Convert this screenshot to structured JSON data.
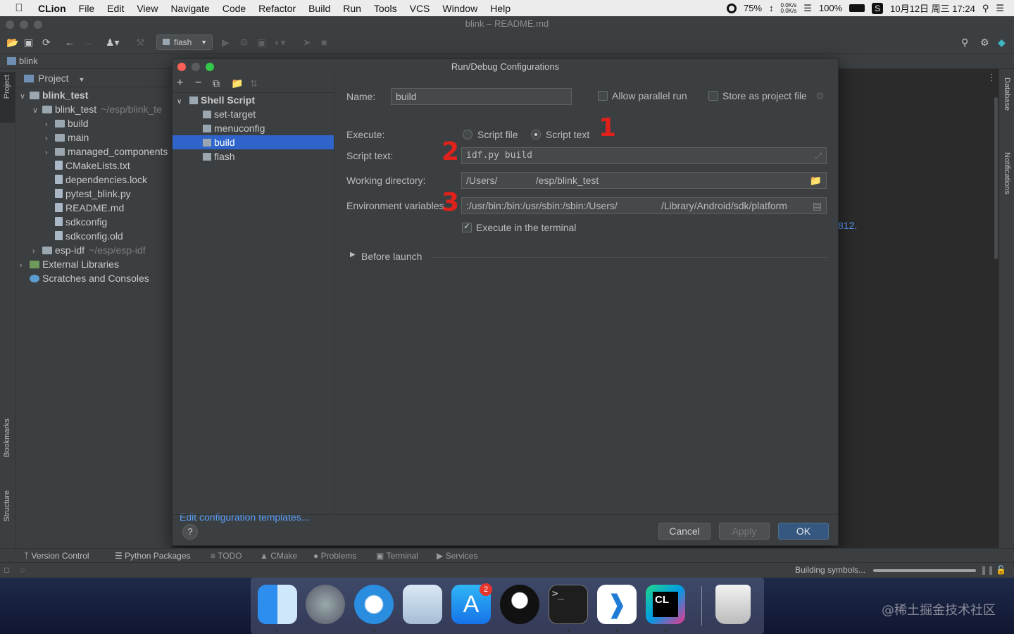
{
  "menubar": {
    "app": "CLion",
    "items": [
      "File",
      "Edit",
      "View",
      "Navigate",
      "Code",
      "Refactor",
      "Build",
      "Run",
      "Tools",
      "VCS",
      "Window",
      "Help"
    ],
    "cpu": "75%",
    "net_up": "0.0K/s",
    "net_down": "0.0K/s",
    "battery": "100%",
    "datetime": "10月12日 周三  17:24"
  },
  "window": {
    "title": "blink – README.md"
  },
  "toolbar": {
    "run_config": "flash"
  },
  "breadcrumb": {
    "label": "blink"
  },
  "project": {
    "header": "Project",
    "tree": [
      {
        "label": "blink_test",
        "extra": "",
        "indent": 0,
        "arrow": "v",
        "bold": true,
        "kind": "folder"
      },
      {
        "label": "blink_test",
        "extra": "~/esp/blink_te",
        "indent": 1,
        "arrow": "v",
        "bold": false,
        "kind": "folder"
      },
      {
        "label": "build",
        "extra": "",
        "indent": 2,
        "arrow": ">",
        "bold": false,
        "kind": "folder"
      },
      {
        "label": "main",
        "extra": "",
        "indent": 2,
        "arrow": ">",
        "bold": false,
        "kind": "folder"
      },
      {
        "label": "managed_components",
        "extra": "",
        "indent": 2,
        "arrow": ">",
        "bold": false,
        "kind": "folder"
      },
      {
        "label": "CMakeLists.txt",
        "extra": "",
        "indent": 2,
        "arrow": "",
        "bold": false,
        "kind": "file"
      },
      {
        "label": "dependencies.lock",
        "extra": "",
        "indent": 2,
        "arrow": "",
        "bold": false,
        "kind": "file"
      },
      {
        "label": "pytest_blink.py",
        "extra": "",
        "indent": 2,
        "arrow": "",
        "bold": false,
        "kind": "file"
      },
      {
        "label": "README.md",
        "extra": "",
        "indent": 2,
        "arrow": "",
        "bold": false,
        "kind": "file"
      },
      {
        "label": "sdkconfig",
        "extra": "",
        "indent": 2,
        "arrow": "",
        "bold": false,
        "kind": "file"
      },
      {
        "label": "sdkconfig.old",
        "extra": "",
        "indent": 2,
        "arrow": "",
        "bold": false,
        "kind": "file"
      },
      {
        "label": "esp-idf",
        "extra": "~/esp/esp-idf",
        "indent": 1,
        "arrow": ">",
        "bold": false,
        "kind": "folder"
      },
      {
        "label": "External Libraries",
        "extra": "",
        "indent": 0,
        "arrow": ">",
        "bold": false,
        "kind": "lib"
      },
      {
        "label": "Scratches and Consoles",
        "extra": "",
        "indent": 0,
        "arrow": "",
        "bold": false,
        "kind": "scratch"
      }
    ]
  },
  "side": {
    "project_tab": "Project",
    "bookmarks_tab": "Bookmarks",
    "structure_tab": "Structure",
    "database_tab": "Database",
    "notifications_tab": "Notifications"
  },
  "editor": {
    "partial_text": "812."
  },
  "dialog": {
    "title": "Run/Debug Configurations",
    "category": "Shell Script",
    "configs": [
      "set-target",
      "menuconfig",
      "build",
      "flash"
    ],
    "selected": "build",
    "edit_templates": "Edit configuration templates...",
    "name_label": "Name:",
    "name_value": "build",
    "allow_parallel": "Allow parallel run",
    "store_as_project": "Store as project file",
    "execute_label": "Execute:",
    "script_file": "Script file",
    "script_text_option": "Script text",
    "script_text_label": "Script text:",
    "script_text_value": "idf.py build",
    "workdir_label": "Working directory:",
    "workdir_value": "/Users/              /esp/blink_test",
    "env_label": "Environment variables:",
    "env_value": ":/usr/bin:/bin:/usr/sbin:/sbin:/Users/                /Library/Android/sdk/platform",
    "exec_terminal": "Execute in the terminal",
    "before_launch": "Before launch",
    "annotations": [
      "1",
      "2",
      "3"
    ],
    "cancel": "Cancel",
    "apply": "Apply",
    "ok": "OK",
    "help": "?"
  },
  "bottom_tabs": [
    "Version Control",
    "Python Packages",
    "TODO",
    "CMake",
    "Problems",
    "Terminal",
    "Services"
  ],
  "status": {
    "text": "Building symbols..."
  },
  "dock": {
    "apps": [
      "finder-icon",
      "launchpad-icon",
      "safari-icon",
      "mail-icon",
      "app-store-icon",
      "qq-icon",
      "terminal-icon",
      "vscode-icon",
      "clion-icon",
      "trash-icon"
    ],
    "appstore_badge": "2"
  },
  "watermark": "@稀土掘金技术社区",
  "colors": {
    "selection": "#2f65ca",
    "link": "#589df6",
    "annotation": "#e0211c",
    "ok_button": "#365880"
  }
}
